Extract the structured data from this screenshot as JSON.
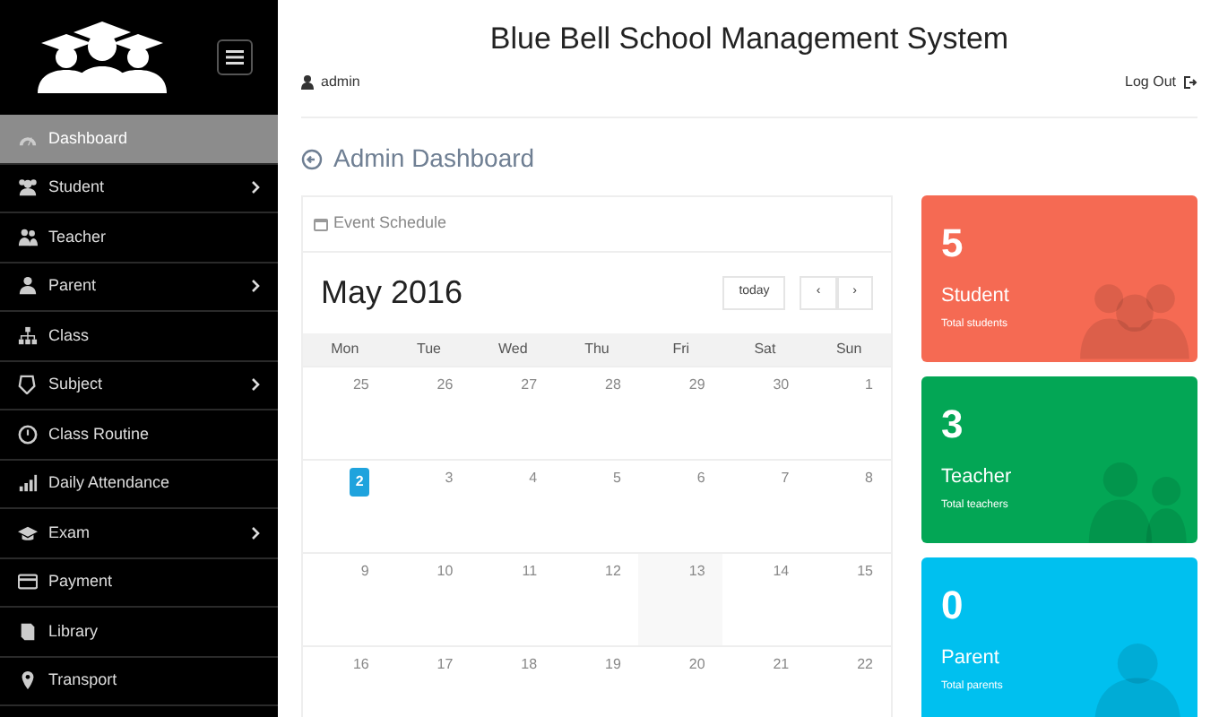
{
  "sidebar": {
    "items": [
      {
        "label": "Dashboard",
        "selected": true,
        "has_submenu": false
      },
      {
        "label": "Student",
        "selected": false,
        "has_submenu": true
      },
      {
        "label": "Teacher",
        "selected": false,
        "has_submenu": false
      },
      {
        "label": "Parent",
        "selected": false,
        "has_submenu": true
      },
      {
        "label": "Class",
        "selected": false,
        "has_submenu": false
      },
      {
        "label": "Subject",
        "selected": false,
        "has_submenu": true
      },
      {
        "label": "Class Routine",
        "selected": false,
        "has_submenu": false
      },
      {
        "label": "Daily Attendance",
        "selected": false,
        "has_submenu": false
      },
      {
        "label": "Exam",
        "selected": false,
        "has_submenu": true
      },
      {
        "label": "Payment",
        "selected": false,
        "has_submenu": false
      },
      {
        "label": "Library",
        "selected": false,
        "has_submenu": false
      },
      {
        "label": "Transport",
        "selected": false,
        "has_submenu": false
      }
    ]
  },
  "header": {
    "title": "Blue Bell School Management System",
    "user": "admin",
    "logout": "Log Out"
  },
  "page_title": "Admin Dashboard",
  "calendar": {
    "panel_title": "Event Schedule",
    "month": "May 2016",
    "today_button": "today",
    "prev": "‹",
    "next": "›",
    "weekdays": [
      "Mon",
      "Tue",
      "Wed",
      "Thu",
      "Fri",
      "Sat",
      "Sun"
    ],
    "weeks": [
      [
        {
          "day": "25",
          "today": false,
          "highlighted": false
        },
        {
          "day": "26",
          "today": false,
          "highlighted": false
        },
        {
          "day": "27",
          "today": false,
          "highlighted": false
        },
        {
          "day": "28",
          "today": false,
          "highlighted": false
        },
        {
          "day": "29",
          "today": false,
          "highlighted": false
        },
        {
          "day": "30",
          "today": false,
          "highlighted": false
        },
        {
          "day": "1",
          "today": false,
          "highlighted": false
        }
      ],
      [
        {
          "day": "2",
          "today": true,
          "highlighted": false
        },
        {
          "day": "3",
          "today": false,
          "highlighted": false
        },
        {
          "day": "4",
          "today": false,
          "highlighted": false
        },
        {
          "day": "5",
          "today": false,
          "highlighted": false
        },
        {
          "day": "6",
          "today": false,
          "highlighted": false
        },
        {
          "day": "7",
          "today": false,
          "highlighted": false
        },
        {
          "day": "8",
          "today": false,
          "highlighted": false
        }
      ],
      [
        {
          "day": "9",
          "today": false,
          "highlighted": false
        },
        {
          "day": "10",
          "today": false,
          "highlighted": false
        },
        {
          "day": "11",
          "today": false,
          "highlighted": false
        },
        {
          "day": "12",
          "today": false,
          "highlighted": false
        },
        {
          "day": "13",
          "today": false,
          "highlighted": true
        },
        {
          "day": "14",
          "today": false,
          "highlighted": false
        },
        {
          "day": "15",
          "today": false,
          "highlighted": false
        }
      ],
      [
        {
          "day": "16",
          "today": false,
          "highlighted": false
        },
        {
          "day": "17",
          "today": false,
          "highlighted": false
        },
        {
          "day": "18",
          "today": false,
          "highlighted": false
        },
        {
          "day": "19",
          "today": false,
          "highlighted": false
        },
        {
          "day": "20",
          "today": false,
          "highlighted": false
        },
        {
          "day": "21",
          "today": false,
          "highlighted": false
        },
        {
          "day": "22",
          "today": false,
          "highlighted": false
        }
      ]
    ]
  },
  "stats": [
    {
      "count": "5",
      "label": "Student",
      "caption": "Total students",
      "color": "#f56a53"
    },
    {
      "count": "3",
      "label": "Teacher",
      "caption": "Total teachers",
      "color": "#03a655"
    },
    {
      "count": "0",
      "label": "Parent",
      "caption": "Total parents",
      "color": "#00c0ef"
    }
  ]
}
